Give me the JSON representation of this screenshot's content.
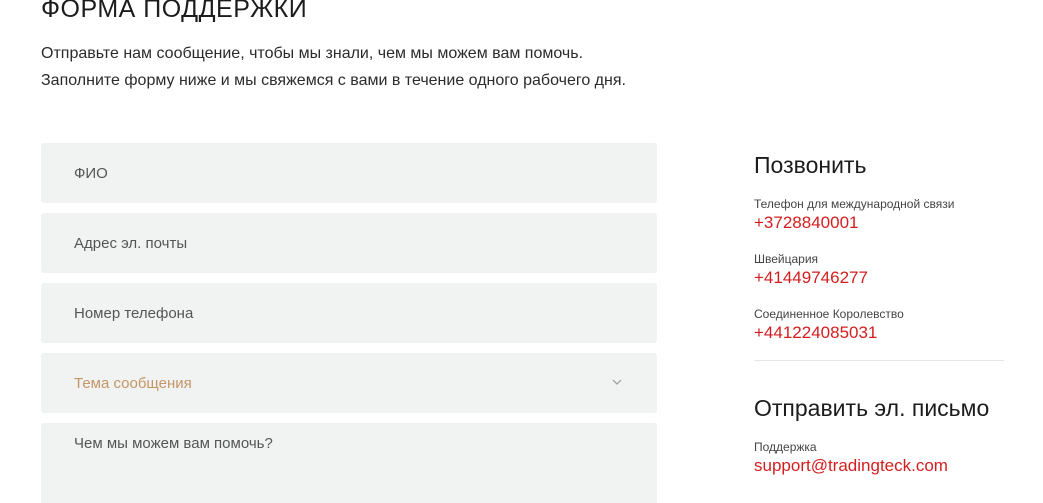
{
  "page": {
    "title": "ФОРМА ПОДДЕРЖКИ",
    "intro_line1": "Отправьте нам сообщение, чтобы мы знали, чем мы можем вам помочь.",
    "intro_line2": "Заполните форму ниже и мы свяжемся с вами в течение одного рабочего дня."
  },
  "form": {
    "name_placeholder": "ФИО",
    "email_placeholder": "Адрес эл. почты",
    "phone_placeholder": "Номер телефона",
    "subject_selected": "Тема сообщения",
    "message_placeholder": "Чем мы можем вам помочь?"
  },
  "call": {
    "heading": "Позвонить",
    "phones": [
      {
        "label": "Телефон для международной связи",
        "number": "+3728840001"
      },
      {
        "label": "Швейцария",
        "number": "+41449746277"
      },
      {
        "label": "Соединенное Королевство",
        "number": "+441224085031"
      }
    ]
  },
  "email": {
    "heading": "Отправить эл. письмо",
    "label": "Поддержка",
    "address": "support@tradingteck.com"
  },
  "colors": {
    "field_bg": "#f1f3f2",
    "link_red": "#d41e1e",
    "select_text": "#c49565"
  },
  "icons": {
    "select_arrow": "chevron-down-icon"
  }
}
